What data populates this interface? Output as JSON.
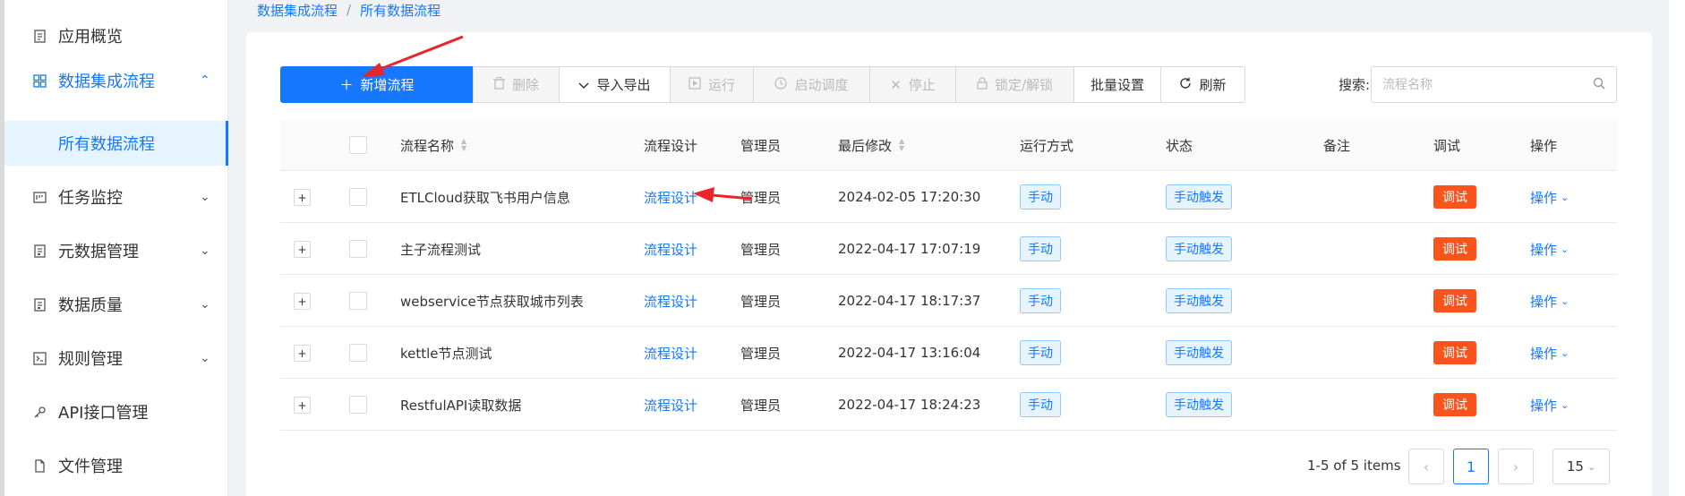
{
  "breadcrumb": {
    "parent": "数据集成流程",
    "separator": "/",
    "current": "所有数据流程"
  },
  "sidebar": {
    "items": [
      {
        "label": "应用概览",
        "icon": "document-icon"
      },
      {
        "label": "数据集成流程",
        "icon": "grid-icon",
        "arrow": "⌃"
      },
      {
        "label": "所有数据流程"
      },
      {
        "label": "任务监控",
        "icon": "monitor-icon",
        "arrow": "⌄"
      },
      {
        "label": "元数据管理",
        "icon": "doc-list-icon",
        "arrow": "⌄"
      },
      {
        "label": "数据质量",
        "icon": "doc-list-icon",
        "arrow": "⌄"
      },
      {
        "label": "规则管理",
        "icon": "terminal-icon",
        "arrow": "⌄"
      },
      {
        "label": "API接口管理",
        "icon": "api-link-icon"
      },
      {
        "label": "文件管理",
        "icon": "file-icon"
      }
    ]
  },
  "toolbar": {
    "new_label": "新增流程",
    "delete_label": "删除",
    "import_export_label": "导入导出",
    "run_label": "运行",
    "schedule_label": "启动调度",
    "stop_label": "停止",
    "lock_label": "锁定/解锁",
    "batch_label": "批量设置",
    "refresh_label": "刷新"
  },
  "search": {
    "label": "搜索:",
    "placeholder": "流程名称"
  },
  "table": {
    "columns": [
      "流程名称",
      "流程设计",
      "管理员",
      "最后修改",
      "运行方式",
      "状态",
      "备注",
      "调试",
      "操作"
    ],
    "rows": [
      {
        "name": "ETLCloud获取飞书用户信息",
        "design": "流程设计",
        "admin": "管理员",
        "modified": "2024-02-05 17:20:30",
        "run_mode": "手动",
        "status": "手动触发",
        "note": "",
        "debug": "调试",
        "op": "操作"
      },
      {
        "name": "主子流程测试",
        "design": "流程设计",
        "admin": "管理员",
        "modified": "2022-04-17 17:07:19",
        "run_mode": "手动",
        "status": "手动触发",
        "note": "",
        "debug": "调试",
        "op": "操作"
      },
      {
        "name": "webservice节点获取城市列表",
        "design": "流程设计",
        "admin": "管理员",
        "modified": "2022-04-17 18:17:37",
        "run_mode": "手动",
        "status": "手动触发",
        "note": "",
        "debug": "调试",
        "op": "操作"
      },
      {
        "name": "kettle节点测试",
        "design": "流程设计",
        "admin": "管理员",
        "modified": "2022-04-17 13:16:04",
        "run_mode": "手动",
        "status": "手动触发",
        "note": "",
        "debug": "调试",
        "op": "操作"
      },
      {
        "name": "RestfulAPI读取数据",
        "design": "流程设计",
        "admin": "管理员",
        "modified": "2022-04-17 18:24:23",
        "run_mode": "手动",
        "status": "手动触发",
        "note": "",
        "debug": "调试",
        "op": "操作"
      }
    ]
  },
  "pagination": {
    "summary": "1-5 of 5 items",
    "current_page": "1",
    "page_size": "15"
  },
  "colors": {
    "primary": "#1677ff",
    "debug": "#fa541c",
    "annotation_arrow": "#e8252b"
  }
}
